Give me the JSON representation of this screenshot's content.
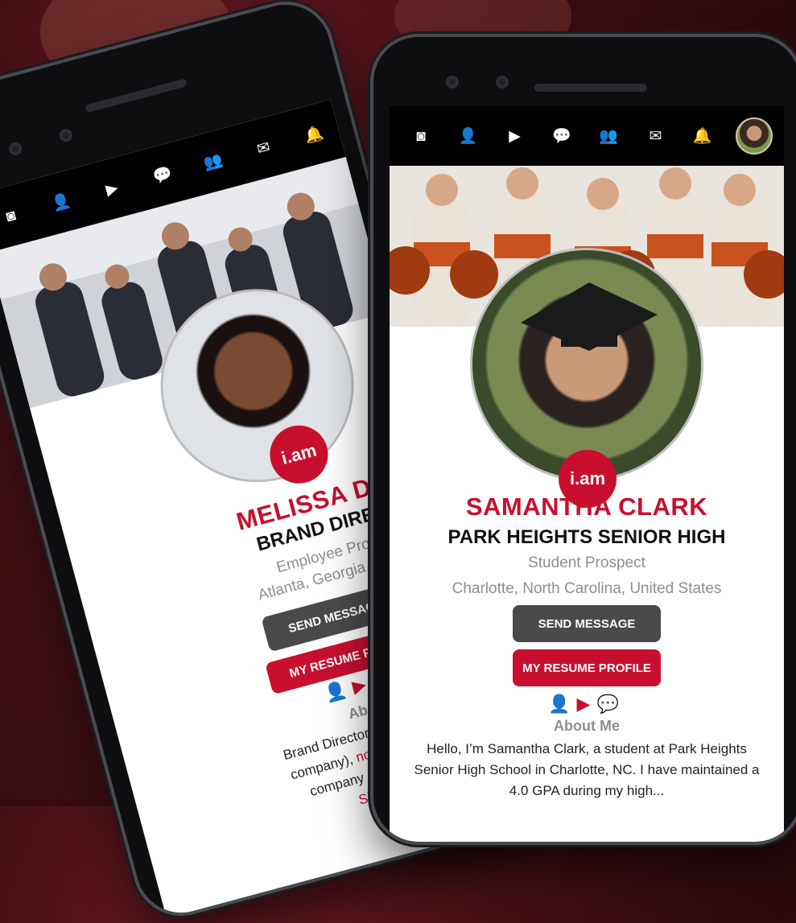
{
  "app": {
    "logo_text": "i.am"
  },
  "topbar_icons": [
    "camera-icon",
    "add-friend-icon",
    "video-icon",
    "chat-icon",
    "group-icon",
    "mail-icon",
    "bell-icon"
  ],
  "front_profile": {
    "name": "SAMANTHA CLARK",
    "headline": "PARK HEIGHTS SENIOR HIGH",
    "prospect_type": "Student Prospect",
    "location": "Charlotte, North Carolina, United States",
    "send_message_label": "SEND MESSAGE",
    "resume_label": "MY RESUME PROFILE",
    "about_title": "About Me",
    "about_text": "Hello, I’m Samantha Clark, a student at Park Heights Senior High School in Charlotte, NC. I have maintained a 4.0 GPA during my high..."
  },
  "back_profile": {
    "name": "MELISSA DUP",
    "headline": "BRAND DIRECT",
    "prospect_type": "Employee Prospe",
    "location": "Atlanta, Georgia, Unite",
    "send_message_label": "SEND MESSAGE",
    "resume_label": "MY RESUME PRO",
    "about_title": "About M",
    "about_line1": "Brand Director with Norex",
    "about_line2_prefix": "company), ",
    "about_link": "nortexinc.com",
    "about_line3": "company day-to-day",
    "show_more": "Show"
  },
  "colors": {
    "accent": "#c8102e",
    "dark_button": "#4a4a4a",
    "topbar": "#000000"
  }
}
